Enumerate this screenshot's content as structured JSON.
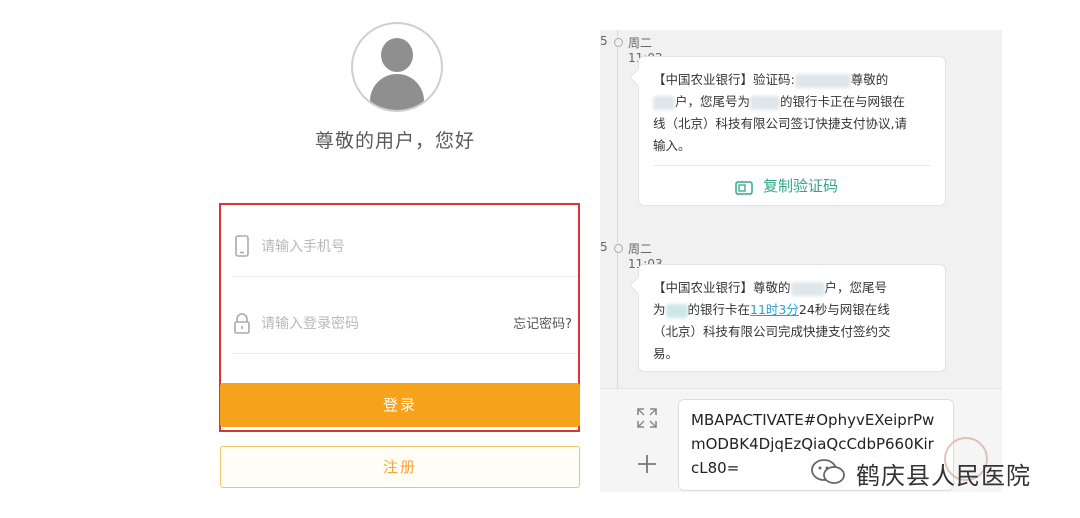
{
  "login": {
    "greeting": "尊敬的用户，您好",
    "phone_placeholder": "请输入手机号",
    "password_placeholder": "请输入登录密码",
    "forgot_password": "忘记密码?",
    "login_button": "登录",
    "register_button": "注册",
    "icons": {
      "avatar": "user-avatar-icon",
      "phone": "phone-icon",
      "lock": "lock-icon"
    }
  },
  "sms": {
    "messages": [
      {
        "index": "5",
        "time": "周二11:02",
        "line1_a": "【中国农业银行】验证码:",
        "line1_b": "尊敬的",
        "line2_a": "户，您尾号为",
        "line2_b": "的银行卡正在与网银在",
        "line3": "线（北京）科技有限公司签订快捷支付协议,请",
        "line4": "输入。",
        "copy_button": "复制验证码"
      },
      {
        "index": "5",
        "time": "周二11:03",
        "line1_a": "【中国农业银行】尊敬的",
        "line1_b": "户，您尾号",
        "line2_a": "为",
        "line2_b": "的银行卡在",
        "line2_link": "11时3分",
        "line2_c": "24秒与网银在线",
        "line3": "（北京）科技有限公司完成快捷支付签约交",
        "line4": "易。"
      }
    ],
    "compose_text": "MBAPACTIVATE#OphyvEXeiprPwmODBK4DjqEzQiaQcCdbP660KircL80="
  },
  "watermark": {
    "text": "鹤庆县人民医院"
  },
  "colors": {
    "login_button": "#f6a21b",
    "highlight_border": "#d8343b",
    "copy_green": "#32a68a",
    "link_blue": "#2a9fd6"
  }
}
